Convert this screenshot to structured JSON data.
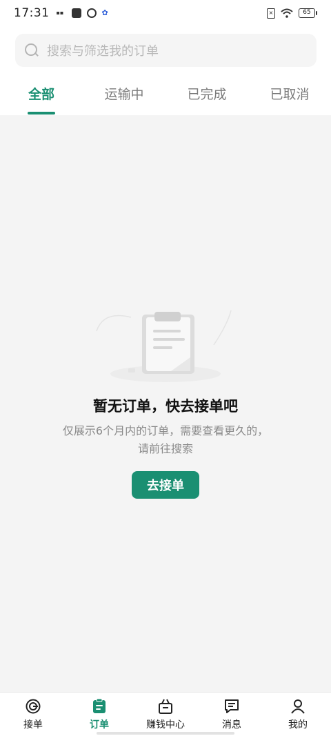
{
  "status_bar": {
    "time": "17:31",
    "battery": "65",
    "left_icons": [
      "notification-icon",
      "message-icon",
      "sync-icon",
      "baidu-icon"
    ],
    "right_icons": [
      "sim-icon",
      "wifi-icon",
      "battery-icon"
    ]
  },
  "search": {
    "placeholder": "搜索与筛选我的订单",
    "icon": "search-icon"
  },
  "tabs": [
    {
      "label": "全部",
      "active": true
    },
    {
      "label": "运输中",
      "active": false
    },
    {
      "label": "已完成",
      "active": false
    },
    {
      "label": "已取消",
      "active": false
    }
  ],
  "empty_state": {
    "icon": "clipboard-icon",
    "title": "暂无订单，快去接单吧",
    "description_line1": "仅展示6个月内的订单，需要查看更久的，",
    "description_line2": "请前往搜索",
    "button_label": "去接单"
  },
  "bottom_nav": [
    {
      "label": "接单",
      "icon": "radar-icon",
      "active": false
    },
    {
      "label": "订单",
      "icon": "order-icon",
      "active": true
    },
    {
      "label": "赚钱中心",
      "icon": "shopping-basket-icon",
      "active": false
    },
    {
      "label": "消息",
      "icon": "message-icon",
      "active": false
    },
    {
      "label": "我的",
      "icon": "user-icon",
      "active": false
    }
  ],
  "colors": {
    "accent": "#1a8f72",
    "background": "#f4f4f4",
    "text_secondary": "#8a8a8a"
  }
}
